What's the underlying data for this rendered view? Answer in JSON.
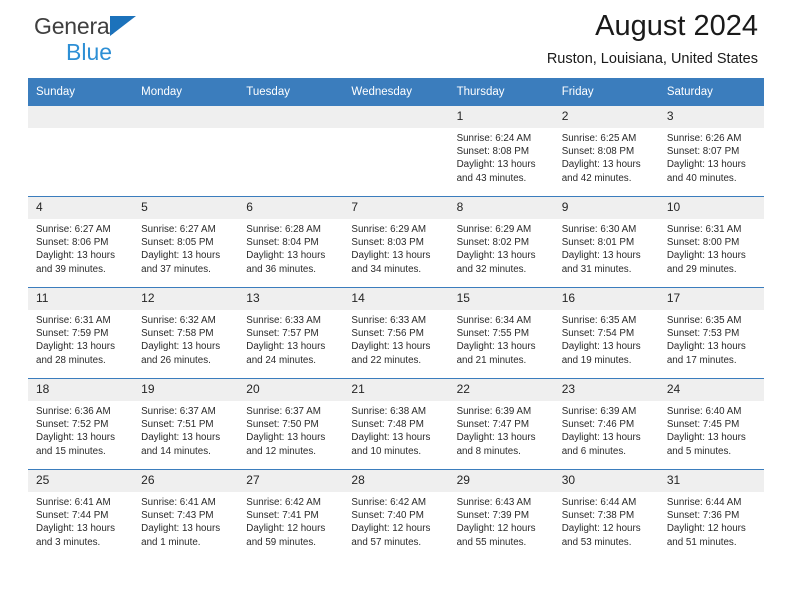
{
  "brand": {
    "name_part1": "General",
    "name_part2": "Blue",
    "triangle_color": "#1c72bb",
    "blue_text_color": "#2d8fd5"
  },
  "header": {
    "title": "August 2024",
    "subtitle": "Ruston, Louisiana, United States"
  },
  "theme": {
    "header_blue": "#3b7dbd",
    "daynum_band": "#efefef",
    "text": "#2a2a2a"
  },
  "weekdays": [
    "Sunday",
    "Monday",
    "Tuesday",
    "Wednesday",
    "Thursday",
    "Friday",
    "Saturday"
  ],
  "labels": {
    "sunrise_prefix": "Sunrise:",
    "sunset_prefix": "Sunset:",
    "daylight_prefix": "Daylight:"
  },
  "weeks": [
    [
      {
        "day": "",
        "empty": true,
        "sunrise": "",
        "sunset": "",
        "daylight": ""
      },
      {
        "day": "",
        "empty": true,
        "sunrise": "",
        "sunset": "",
        "daylight": ""
      },
      {
        "day": "",
        "empty": true,
        "sunrise": "",
        "sunset": "",
        "daylight": ""
      },
      {
        "day": "",
        "empty": true,
        "sunrise": "",
        "sunset": "",
        "daylight": ""
      },
      {
        "day": "1",
        "sunrise": "Sunrise: 6:24 AM",
        "sunset": "Sunset: 8:08 PM",
        "daylight": "Daylight: 13 hours and 43 minutes."
      },
      {
        "day": "2",
        "sunrise": "Sunrise: 6:25 AM",
        "sunset": "Sunset: 8:08 PM",
        "daylight": "Daylight: 13 hours and 42 minutes."
      },
      {
        "day": "3",
        "sunrise": "Sunrise: 6:26 AM",
        "sunset": "Sunset: 8:07 PM",
        "daylight": "Daylight: 13 hours and 40 minutes."
      }
    ],
    [
      {
        "day": "4",
        "sunrise": "Sunrise: 6:27 AM",
        "sunset": "Sunset: 8:06 PM",
        "daylight": "Daylight: 13 hours and 39 minutes."
      },
      {
        "day": "5",
        "sunrise": "Sunrise: 6:27 AM",
        "sunset": "Sunset: 8:05 PM",
        "daylight": "Daylight: 13 hours and 37 minutes."
      },
      {
        "day": "6",
        "sunrise": "Sunrise: 6:28 AM",
        "sunset": "Sunset: 8:04 PM",
        "daylight": "Daylight: 13 hours and 36 minutes."
      },
      {
        "day": "7",
        "sunrise": "Sunrise: 6:29 AM",
        "sunset": "Sunset: 8:03 PM",
        "daylight": "Daylight: 13 hours and 34 minutes."
      },
      {
        "day": "8",
        "sunrise": "Sunrise: 6:29 AM",
        "sunset": "Sunset: 8:02 PM",
        "daylight": "Daylight: 13 hours and 32 minutes."
      },
      {
        "day": "9",
        "sunrise": "Sunrise: 6:30 AM",
        "sunset": "Sunset: 8:01 PM",
        "daylight": "Daylight: 13 hours and 31 minutes."
      },
      {
        "day": "10",
        "sunrise": "Sunrise: 6:31 AM",
        "sunset": "Sunset: 8:00 PM",
        "daylight": "Daylight: 13 hours and 29 minutes."
      }
    ],
    [
      {
        "day": "11",
        "sunrise": "Sunrise: 6:31 AM",
        "sunset": "Sunset: 7:59 PM",
        "daylight": "Daylight: 13 hours and 28 minutes."
      },
      {
        "day": "12",
        "sunrise": "Sunrise: 6:32 AM",
        "sunset": "Sunset: 7:58 PM",
        "daylight": "Daylight: 13 hours and 26 minutes."
      },
      {
        "day": "13",
        "sunrise": "Sunrise: 6:33 AM",
        "sunset": "Sunset: 7:57 PM",
        "daylight": "Daylight: 13 hours and 24 minutes."
      },
      {
        "day": "14",
        "sunrise": "Sunrise: 6:33 AM",
        "sunset": "Sunset: 7:56 PM",
        "daylight": "Daylight: 13 hours and 22 minutes."
      },
      {
        "day": "15",
        "sunrise": "Sunrise: 6:34 AM",
        "sunset": "Sunset: 7:55 PM",
        "daylight": "Daylight: 13 hours and 21 minutes."
      },
      {
        "day": "16",
        "sunrise": "Sunrise: 6:35 AM",
        "sunset": "Sunset: 7:54 PM",
        "daylight": "Daylight: 13 hours and 19 minutes."
      },
      {
        "day": "17",
        "sunrise": "Sunrise: 6:35 AM",
        "sunset": "Sunset: 7:53 PM",
        "daylight": "Daylight: 13 hours and 17 minutes."
      }
    ],
    [
      {
        "day": "18",
        "sunrise": "Sunrise: 6:36 AM",
        "sunset": "Sunset: 7:52 PM",
        "daylight": "Daylight: 13 hours and 15 minutes."
      },
      {
        "day": "19",
        "sunrise": "Sunrise: 6:37 AM",
        "sunset": "Sunset: 7:51 PM",
        "daylight": "Daylight: 13 hours and 14 minutes."
      },
      {
        "day": "20",
        "sunrise": "Sunrise: 6:37 AM",
        "sunset": "Sunset: 7:50 PM",
        "daylight": "Daylight: 13 hours and 12 minutes."
      },
      {
        "day": "21",
        "sunrise": "Sunrise: 6:38 AM",
        "sunset": "Sunset: 7:48 PM",
        "daylight": "Daylight: 13 hours and 10 minutes."
      },
      {
        "day": "22",
        "sunrise": "Sunrise: 6:39 AM",
        "sunset": "Sunset: 7:47 PM",
        "daylight": "Daylight: 13 hours and 8 minutes."
      },
      {
        "day": "23",
        "sunrise": "Sunrise: 6:39 AM",
        "sunset": "Sunset: 7:46 PM",
        "daylight": "Daylight: 13 hours and 6 minutes."
      },
      {
        "day": "24",
        "sunrise": "Sunrise: 6:40 AM",
        "sunset": "Sunset: 7:45 PM",
        "daylight": "Daylight: 13 hours and 5 minutes."
      }
    ],
    [
      {
        "day": "25",
        "sunrise": "Sunrise: 6:41 AM",
        "sunset": "Sunset: 7:44 PM",
        "daylight": "Daylight: 13 hours and 3 minutes."
      },
      {
        "day": "26",
        "sunrise": "Sunrise: 6:41 AM",
        "sunset": "Sunset: 7:43 PM",
        "daylight": "Daylight: 13 hours and 1 minute."
      },
      {
        "day": "27",
        "sunrise": "Sunrise: 6:42 AM",
        "sunset": "Sunset: 7:41 PM",
        "daylight": "Daylight: 12 hours and 59 minutes."
      },
      {
        "day": "28",
        "sunrise": "Sunrise: 6:42 AM",
        "sunset": "Sunset: 7:40 PM",
        "daylight": "Daylight: 12 hours and 57 minutes."
      },
      {
        "day": "29",
        "sunrise": "Sunrise: 6:43 AM",
        "sunset": "Sunset: 7:39 PM",
        "daylight": "Daylight: 12 hours and 55 minutes."
      },
      {
        "day": "30",
        "sunrise": "Sunrise: 6:44 AM",
        "sunset": "Sunset: 7:38 PM",
        "daylight": "Daylight: 12 hours and 53 minutes."
      },
      {
        "day": "31",
        "sunrise": "Sunrise: 6:44 AM",
        "sunset": "Sunset: 7:36 PM",
        "daylight": "Daylight: 12 hours and 51 minutes."
      }
    ]
  ]
}
